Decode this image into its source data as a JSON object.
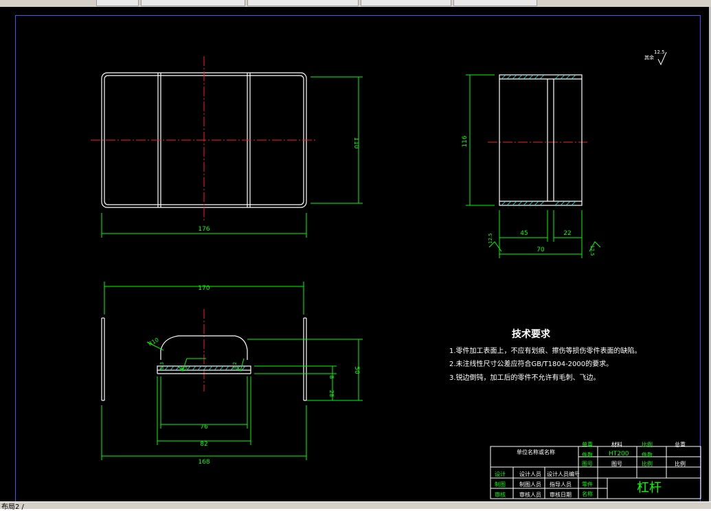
{
  "status": {
    "left_text": "布局2 /"
  },
  "drawing": {
    "dims": {
      "top_width": "176",
      "top_height": "110",
      "side_height": "116",
      "side_45": "45",
      "side_22": "22",
      "side_70": "70",
      "bottom_170": "170",
      "bottom_168": "168",
      "bottom_76": "76",
      "bottom_82": "82",
      "bottom_50": "50",
      "bottom_8": "8",
      "bottom_28": "28",
      "radius": "R10",
      "rough_a": "6.3",
      "rough_b": "3.2",
      "rough_c": "3.2",
      "rough_d": "12.5",
      "rough_e": "12.5",
      "rough_f": "3.2"
    },
    "rough_note": {
      "label": "其余",
      "value": "12.5"
    },
    "requirements": {
      "title": "技术要求",
      "items": [
        "1.零件加工表面上，不应有划痕、擦伤等损伤零件表面的缺陷。",
        "2.未注线性尺寸公差应符合GB/T1804-2000的要求。",
        "3.锐边倒钝，加工后的零件不允许有毛刺、飞边。"
      ]
    }
  },
  "title_block": {
    "company": "单位名称或名称",
    "quantity_label": "单重",
    "material_label": "材料",
    "material_value": "HT200",
    "scale_label": "比例",
    "weight_label": "总重",
    "count_label": "件数",
    "drawing_no_label": "图号",
    "ratio_label": "比例",
    "design_label": "设计",
    "designer": "设计人员",
    "designer_no": "设计人员编号",
    "drawn_label": "制图",
    "drawn_by": "制图人员",
    "guide_label": "指导人员",
    "check_label": "审核",
    "checker": "审核人员",
    "check_date": "审核日期",
    "part_label": "零件",
    "name_label": "名称",
    "part_name": "杠杆"
  }
}
